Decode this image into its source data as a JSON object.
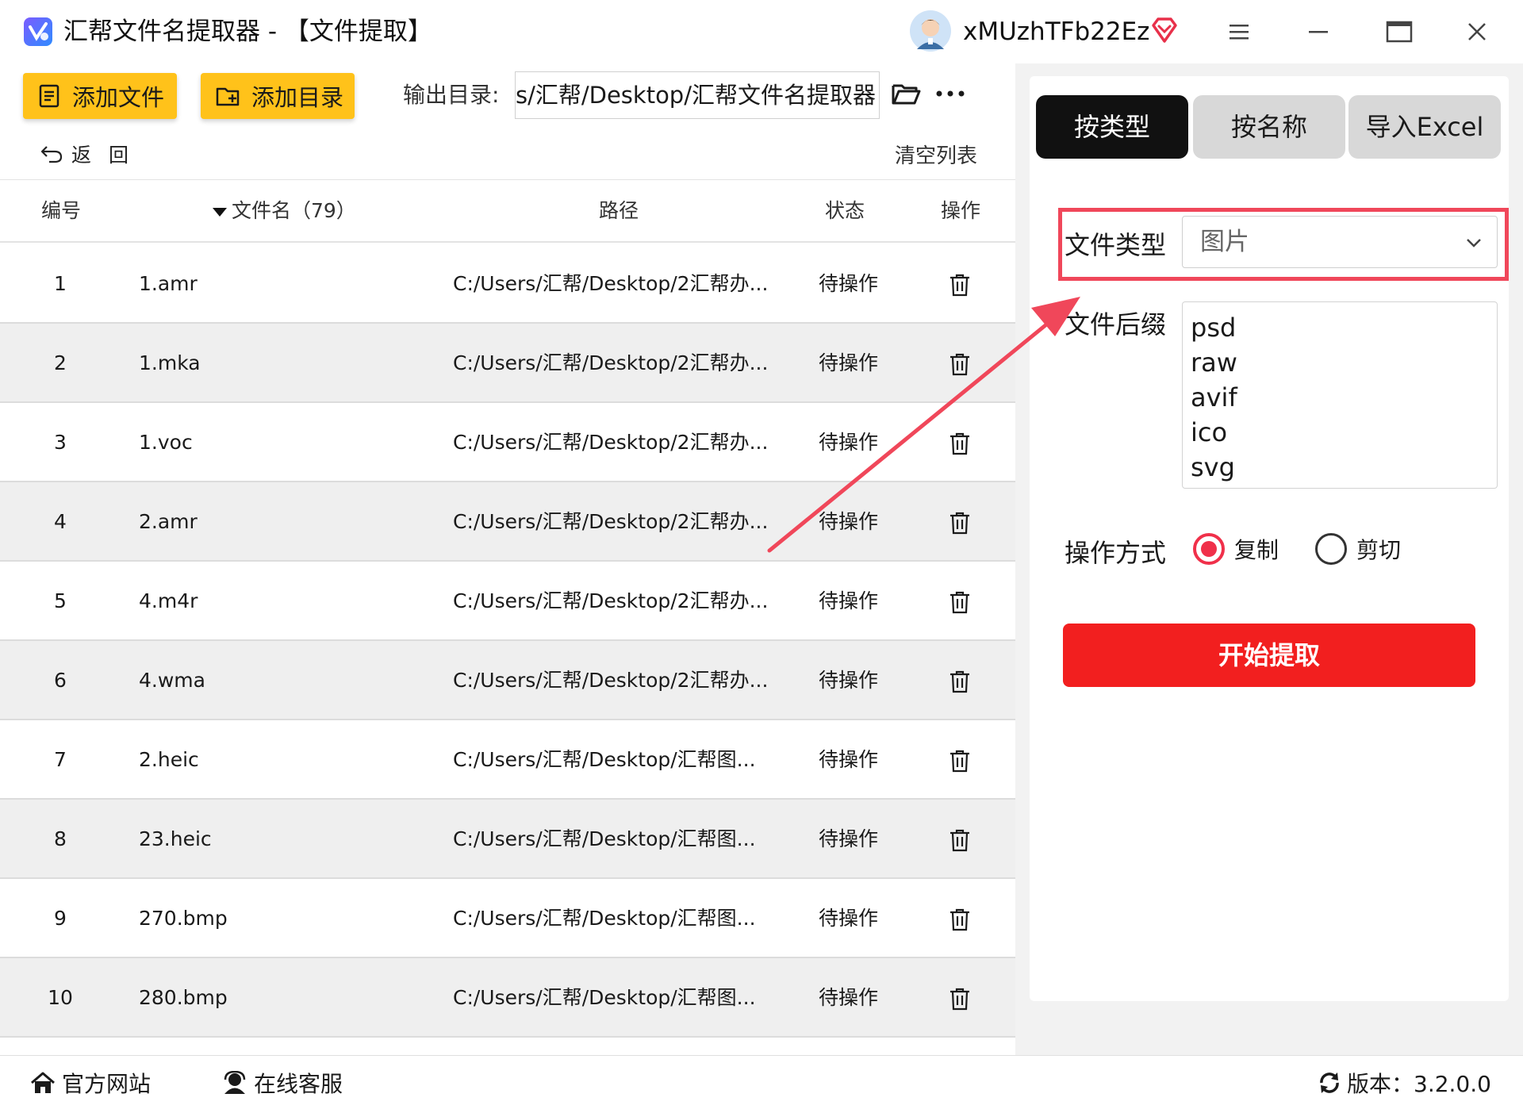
{
  "titlebar": {
    "title": "汇帮文件名提取器 - 【文件提取】",
    "username": "xMUzhTFb22Ez"
  },
  "toolbar": {
    "add_file_label": "添加文件",
    "add_dir_label": "添加目录",
    "output_label": "输出目录:",
    "output_path": "C:/Users/汇帮/Desktop/汇帮文件名提取器",
    "back_label": "返回",
    "clear_label": "清空列表"
  },
  "table": {
    "headers": {
      "no": "编号",
      "name": "文件名（79）",
      "path": "路径",
      "status": "状态",
      "op": "操作"
    },
    "rows": [
      {
        "no": "1",
        "name": "1.amr",
        "path": "C:/Users/汇帮/Desktop/2汇帮办...",
        "status": "待操作"
      },
      {
        "no": "2",
        "name": "1.mka",
        "path": "C:/Users/汇帮/Desktop/2汇帮办...",
        "status": "待操作"
      },
      {
        "no": "3",
        "name": "1.voc",
        "path": "C:/Users/汇帮/Desktop/2汇帮办...",
        "status": "待操作"
      },
      {
        "no": "4",
        "name": "2.amr",
        "path": "C:/Users/汇帮/Desktop/2汇帮办...",
        "status": "待操作"
      },
      {
        "no": "5",
        "name": "4.m4r",
        "path": "C:/Users/汇帮/Desktop/2汇帮办...",
        "status": "待操作"
      },
      {
        "no": "6",
        "name": "4.wma",
        "path": "C:/Users/汇帮/Desktop/2汇帮办...",
        "status": "待操作"
      },
      {
        "no": "7",
        "name": "2.heic",
        "path": "C:/Users/汇帮/Desktop/汇帮图...",
        "status": "待操作"
      },
      {
        "no": "8",
        "name": "23.heic",
        "path": "C:/Users/汇帮/Desktop/汇帮图...",
        "status": "待操作"
      },
      {
        "no": "9",
        "name": "270.bmp",
        "path": "C:/Users/汇帮/Desktop/汇帮图...",
        "status": "待操作"
      },
      {
        "no": "10",
        "name": "280.bmp",
        "path": "C:/Users/汇帮/Desktop/汇帮图...",
        "status": "待操作"
      }
    ]
  },
  "right_panel": {
    "tabs": [
      {
        "label": "按类型",
        "active": true
      },
      {
        "label": "按名称",
        "active": false
      },
      {
        "label": "导入Excel",
        "active": false
      }
    ],
    "file_type_label": "文件类型",
    "file_type_value": "图片",
    "suffix_label": "文件后缀",
    "suffixes": [
      "psd",
      "raw",
      "avif",
      "ico",
      "svg"
    ],
    "mode_label": "操作方式",
    "mode_copy": "复制",
    "mode_cut": "剪切",
    "mode_selected": "复制",
    "start_label": "开始提取"
  },
  "footer": {
    "site_label": "官方网站",
    "service_label": "在线客服",
    "version_label": "版本：3.2.0.0"
  },
  "colors": {
    "accent_yellow": "#ffc21a",
    "start_red": "#f21f1f",
    "highlight_red": "#f0475a",
    "tab_active": "#111111"
  },
  "icons": {
    "app_logo": "app-logo-icon",
    "vip": "vip-diamond-icon",
    "menu": "hamburger-icon",
    "minimize": "minimize-icon",
    "maximize": "maximize-icon",
    "close": "close-icon",
    "add_file": "add-file-icon",
    "add_dir": "add-folder-icon",
    "folder": "folder-open-icon",
    "more": "more-dots-icon",
    "back": "back-arrow-icon",
    "delete": "trash-icon",
    "dropdown": "chevron-down-icon",
    "home": "home-icon",
    "service": "service-icon",
    "refresh": "refresh-icon"
  }
}
